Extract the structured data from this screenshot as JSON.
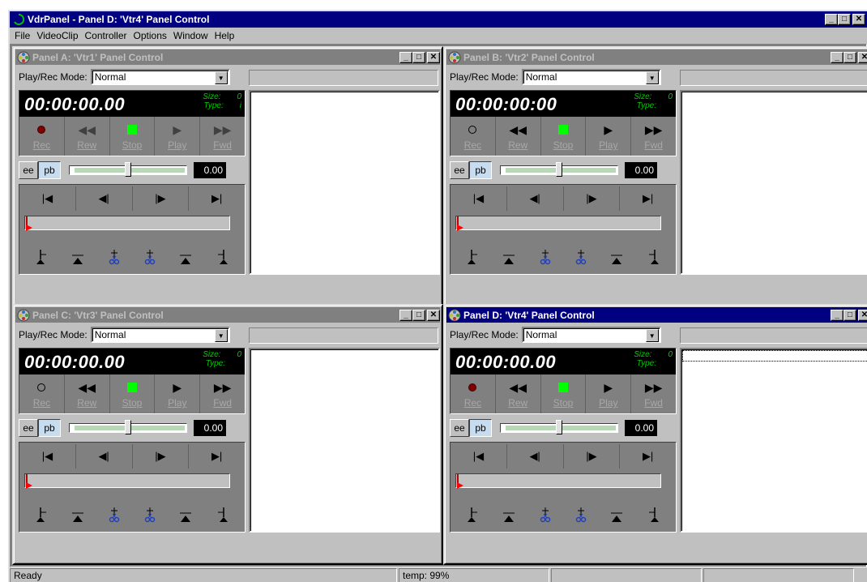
{
  "window": {
    "title": "VdrPanel - Panel D: 'Vtr4' Panel Control"
  },
  "menu": [
    "File",
    "VideoClip",
    "Controller",
    "Options",
    "Window",
    "Help"
  ],
  "panels": [
    {
      "title": "Panel A: 'Vtr1' Panel Control",
      "mode_label": "Play/Rec Mode:",
      "mode_value": "Normal",
      "timecode": "00:00:00.00",
      "size_label": "Size:",
      "size_value": "0",
      "type_label": "Type:",
      "type_value": "i",
      "rec_label": "Rec",
      "rew_label": "Rew",
      "stop_label": "Stop",
      "play_label": "Play",
      "fwd_label": "Fwd",
      "ee_label": "ee",
      "pb_label": "pb",
      "speed": "0.00",
      "active": false
    },
    {
      "title": "Panel B: 'Vtr2' Panel Control",
      "mode_label": "Play/Rec Mode:",
      "mode_value": "Normal",
      "timecode": "00:00:00:00",
      "size_label": "Size:",
      "size_value": "0",
      "type_label": "Type:",
      "type_value": "",
      "rec_label": "Rec",
      "rew_label": "Rew",
      "stop_label": "Stop",
      "play_label": "Play",
      "fwd_label": "Fwd",
      "ee_label": "ee",
      "pb_label": "pb",
      "speed": "0.00",
      "active": false
    },
    {
      "title": "Panel C: 'Vtr3' Panel Control",
      "mode_label": "Play/Rec Mode:",
      "mode_value": "Normal",
      "timecode": "00:00:00.00",
      "size_label": "Size:",
      "size_value": "0",
      "type_label": "Type:",
      "type_value": "",
      "rec_label": "Rec",
      "rew_label": "Rew",
      "stop_label": "Stop",
      "play_label": "Play",
      "fwd_label": "Fwd",
      "ee_label": "ee",
      "pb_label": "pb",
      "speed": "0.00",
      "active": false
    },
    {
      "title": "Panel D: 'Vtr4' Panel Control",
      "mode_label": "Play/Rec Mode:",
      "mode_value": "Normal",
      "timecode": "00:00:00.00",
      "size_label": "Size:",
      "size_value": "0",
      "type_label": "Type:",
      "type_value": "",
      "rec_label": "Rec",
      "rew_label": "Rew",
      "stop_label": "Stop",
      "play_label": "Play",
      "fwd_label": "Fwd",
      "ee_label": "ee",
      "pb_label": "pb",
      "speed": "0.00",
      "active": true
    }
  ],
  "statusbar": {
    "left": "Ready",
    "temp": "temp: 99%"
  },
  "colors": {
    "active_title": "#000080",
    "inactive_title": "#808080",
    "stop_indicator": "#00ff00",
    "timecode_meta": "#00cc00"
  }
}
